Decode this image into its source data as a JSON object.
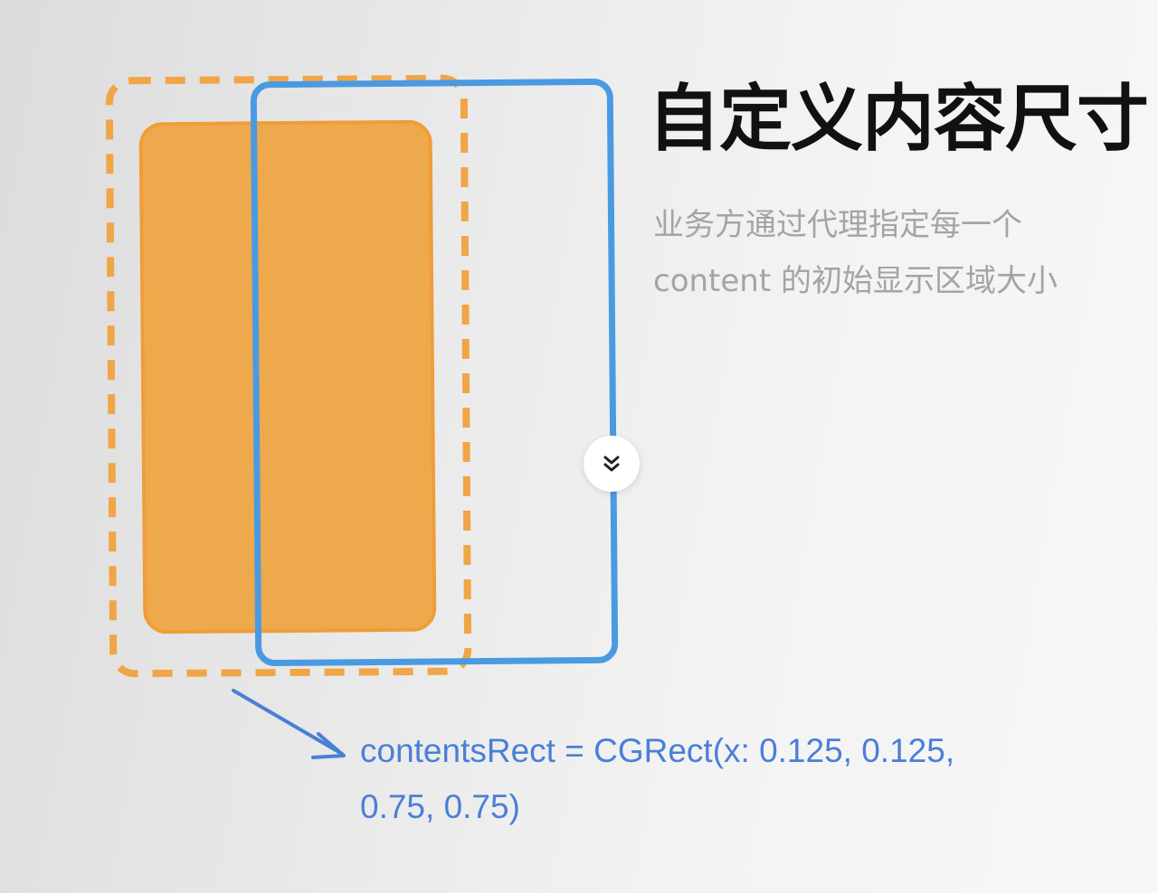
{
  "title": "自定义内容尺寸",
  "description": {
    "line1": "业务方通过代理指定每一个",
    "line2": "content 的初始显示区域大小"
  },
  "code": {
    "line1": "contentsRect = CGRect(x: 0.125, 0.125,",
    "line2": "0.75, 0.75)"
  },
  "colors": {
    "orange_dashed": "#f0a546",
    "orange_fill": "#efa94d",
    "blue_outline": "#4a9ae2",
    "arrow_blue": "#4a7fd6",
    "title": "#111111",
    "description": "#a4a4a4"
  },
  "icons": {
    "scroll": "chevron-double-down-icon",
    "arrow": "arrow-down-right-icon"
  }
}
